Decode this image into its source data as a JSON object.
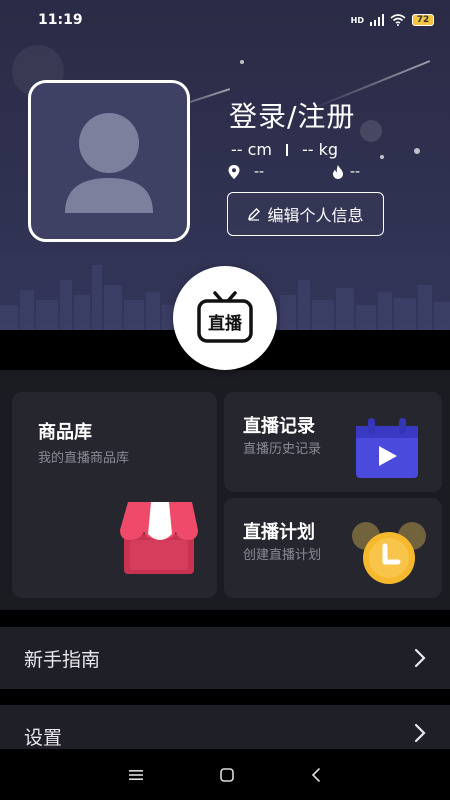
{
  "status_bar": {
    "time": "11:19",
    "battery": "72",
    "network": "HD"
  },
  "profile": {
    "login_title": "登录/注册",
    "height": "-- cm",
    "weight": "-- kg",
    "location": "--",
    "heat": "--",
    "edit_button": "编辑个人信息"
  },
  "live_badge": {
    "label": "直播"
  },
  "cards": {
    "product_library": {
      "title": "商品库",
      "subtitle": "我的直播商品库"
    },
    "live_records": {
      "title": "直播记录",
      "subtitle": "直播历史记录"
    },
    "live_plan": {
      "title": "直播计划",
      "subtitle": "创建直播计划"
    }
  },
  "menu": [
    {
      "label": "新手指南"
    },
    {
      "label": "设置"
    }
  ],
  "colors": {
    "hero_bg": "#2f3150",
    "panel_bg": "#1b1b22",
    "card_bg": "#26262f",
    "calendar_blue": "#4a4adc",
    "shop_red": "#e8435f",
    "clock_yellow": "#f6b82d"
  }
}
